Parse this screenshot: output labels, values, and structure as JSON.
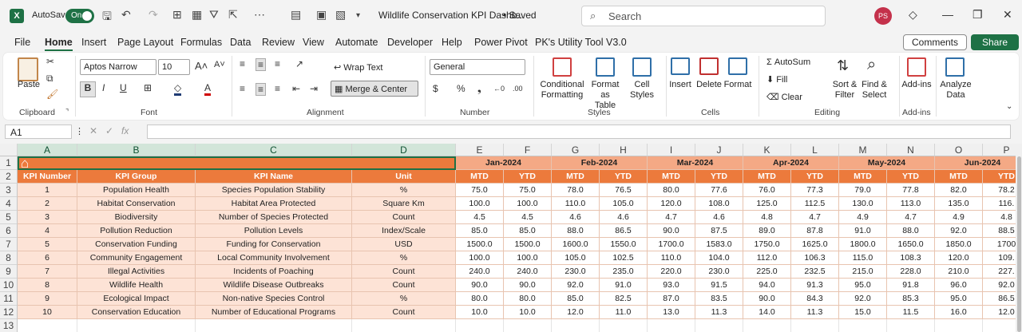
{
  "titlebar": {
    "autosave_label": "AutoSave",
    "toggle_state": "On",
    "doc_name": "Wildlife Conservation KPI Dashb...",
    "saved_status": "• Saved",
    "search_placeholder": "Search",
    "avatar_initials": "PS"
  },
  "menu": {
    "tabs": [
      "File",
      "Home",
      "Insert",
      "Page Layout",
      "Formulas",
      "Data",
      "Review",
      "View",
      "Automate",
      "Developer",
      "Help",
      "Power Pivot",
      "PK's Utility Tool V3.0"
    ],
    "active": "Home",
    "comments": "Comments",
    "share": "Share"
  },
  "ribbon": {
    "clipboard": {
      "paste": "Paste",
      "label": "Clipboard"
    },
    "font": {
      "name": "Aptos Narrow",
      "size": "10",
      "label": "Font"
    },
    "alignment": {
      "wrap": "Wrap Text",
      "merge": "Merge & Center",
      "label": "Alignment"
    },
    "number": {
      "format": "General",
      "label": "Number"
    },
    "styles": {
      "cond": "Conditional",
      "cond2": "Formatting",
      "fmt": "Format as",
      "fmt2": "Table",
      "cell": "Cell",
      "cell2": "Styles",
      "label": "Styles"
    },
    "cells": {
      "insert": "Insert",
      "delete": "Delete",
      "format": "Format",
      "label": "Cells"
    },
    "editing": {
      "autosum": "AutoSum",
      "fill": "Fill",
      "clear": "Clear",
      "sort": "Sort &",
      "sort2": "Filter",
      "find": "Find &",
      "find2": "Select",
      "label": "Editing"
    },
    "addins": {
      "btn": "Add-ins",
      "label": "Add-ins"
    },
    "analyze": {
      "line1": "Analyze",
      "line2": "Data"
    }
  },
  "formula_bar": {
    "name_box": "A1",
    "formula": ""
  },
  "colors": {
    "orange": "#ec7a3c",
    "orange_light": "#f4a985",
    "peach": "#fde3d6",
    "white": "#ffffff",
    "excel_green": "#1e7145"
  },
  "sheet": {
    "columns": [
      "A",
      "B",
      "C",
      "D",
      "E",
      "F",
      "G",
      "H",
      "I",
      "J",
      "K",
      "L",
      "M",
      "N",
      "O",
      "P"
    ],
    "row_numbers": [
      "1",
      "2",
      "3",
      "4",
      "5",
      "6",
      "7",
      "8",
      "9",
      "10",
      "11",
      "12",
      "13"
    ],
    "months": [
      "Jan-2024",
      "Feb-2024",
      "Mar-2024",
      "Apr-2024",
      "May-2024",
      "Jun-2024"
    ],
    "header": [
      "KPI Number",
      "KPI Group",
      "KPI Name",
      "Unit"
    ],
    "mtd": "MTD",
    "ytd": "YTD",
    "rows": [
      {
        "num": "1",
        "group": "Population Health",
        "name": "Species Population Stability",
        "unit": "%",
        "vals": [
          "75.0",
          "75.0",
          "78.0",
          "76.5",
          "80.0",
          "77.6",
          "76.0",
          "77.3",
          "79.0",
          "77.8",
          "82.0",
          "78.2"
        ]
      },
      {
        "num": "2",
        "group": "Habitat Conservation",
        "name": "Habitat Area Protected",
        "unit": "Square Km",
        "vals": [
          "100.0",
          "100.0",
          "110.0",
          "105.0",
          "120.0",
          "108.0",
          "125.0",
          "112.5",
          "130.0",
          "113.0",
          "135.0",
          "116."
        ]
      },
      {
        "num": "3",
        "group": "Biodiversity",
        "name": "Number of Species Protected",
        "unit": "Count",
        "vals": [
          "4.5",
          "4.5",
          "4.6",
          "4.6",
          "4.7",
          "4.6",
          "4.8",
          "4.7",
          "4.9",
          "4.7",
          "4.9",
          "4.8"
        ]
      },
      {
        "num": "4",
        "group": "Pollution Reduction",
        "name": "Pollution Levels",
        "unit": "Index/Scale",
        "vals": [
          "85.0",
          "85.0",
          "88.0",
          "86.5",
          "90.0",
          "87.5",
          "89.0",
          "87.8",
          "91.0",
          "88.0",
          "92.0",
          "88.5"
        ]
      },
      {
        "num": "5",
        "group": "Conservation Funding",
        "name": "Funding for Conservation",
        "unit": "USD",
        "vals": [
          "1500.0",
          "1500.0",
          "1600.0",
          "1550.0",
          "1700.0",
          "1583.0",
          "1750.0",
          "1625.0",
          "1800.0",
          "1650.0",
          "1850.0",
          "1700"
        ]
      },
      {
        "num": "6",
        "group": "Community Engagement",
        "name": "Local Community Involvement",
        "unit": "%",
        "vals": [
          "100.0",
          "100.0",
          "105.0",
          "102.5",
          "110.0",
          "104.0",
          "112.0",
          "106.3",
          "115.0",
          "108.3",
          "120.0",
          "109."
        ]
      },
      {
        "num": "7",
        "group": "Illegal Activities",
        "name": "Incidents of Poaching",
        "unit": "Count",
        "vals": [
          "240.0",
          "240.0",
          "230.0",
          "235.0",
          "220.0",
          "230.0",
          "225.0",
          "232.5",
          "215.0",
          "228.0",
          "210.0",
          "227."
        ]
      },
      {
        "num": "8",
        "group": "Wildlife Health",
        "name": "Wildlife Disease Outbreaks",
        "unit": "Count",
        "vals": [
          "90.0",
          "90.0",
          "92.0",
          "91.0",
          "93.0",
          "91.5",
          "94.0",
          "91.3",
          "95.0",
          "91.8",
          "96.0",
          "92.0"
        ]
      },
      {
        "num": "9",
        "group": "Ecological Impact",
        "name": "Non-native Species Control",
        "unit": "%",
        "vals": [
          "80.0",
          "80.0",
          "85.0",
          "82.5",
          "87.0",
          "83.5",
          "90.0",
          "84.3",
          "92.0",
          "85.3",
          "95.0",
          "86.5"
        ]
      },
      {
        "num": "10",
        "group": "Conservation Education",
        "name": "Number of Educational Programs",
        "unit": "Count",
        "vals": [
          "10.0",
          "10.0",
          "12.0",
          "11.0",
          "13.0",
          "11.3",
          "14.0",
          "11.3",
          "15.0",
          "11.5",
          "16.0",
          "12.0"
        ]
      }
    ]
  }
}
